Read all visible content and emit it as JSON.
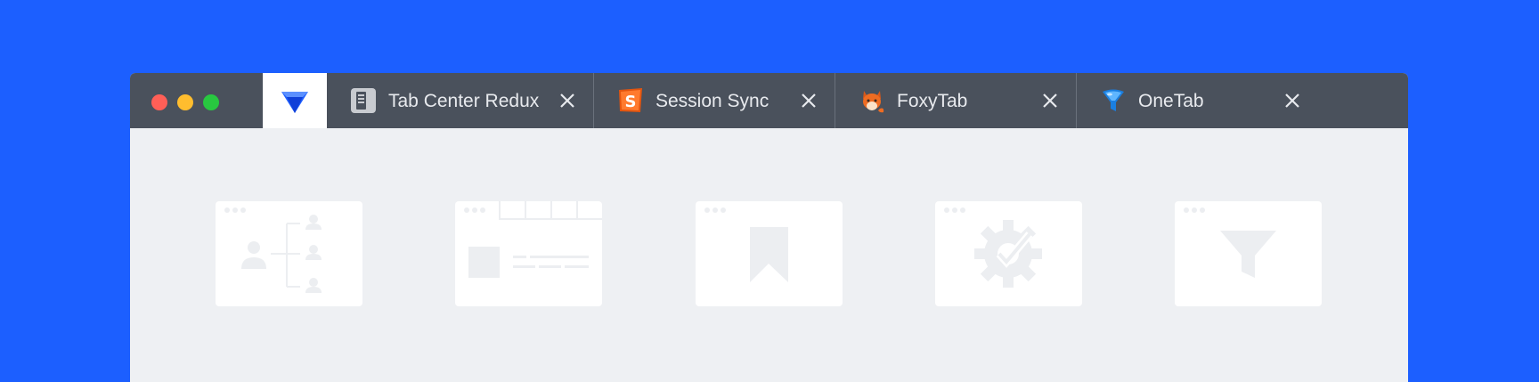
{
  "window": {
    "traffic_lights": [
      "close",
      "minimize",
      "zoom"
    ]
  },
  "tabs": {
    "pinned": {
      "icon": "blue-gem-icon"
    },
    "items": [
      {
        "label": "Tab Center Redux",
        "icon": "document-icon",
        "close": "close-icon"
      },
      {
        "label": "Session Sync",
        "icon": "s-logo-icon",
        "close": "close-icon"
      },
      {
        "label": "FoxyTab",
        "icon": "fox-icon",
        "close": "close-icon"
      },
      {
        "label": "OneTab",
        "icon": "funnel-icon",
        "close": "close-icon"
      }
    ]
  },
  "placeholders": [
    {
      "icon": "org-chart-icon"
    },
    {
      "icon": "tab-layout-icon"
    },
    {
      "icon": "bookmark-icon"
    },
    {
      "icon": "gear-check-icon"
    },
    {
      "icon": "filter-icon"
    }
  ],
  "colors": {
    "background": "#1c5fff",
    "tabbar": "#4a515c",
    "content": "#eef0f3",
    "placeholder_shapes": "#eceef1"
  }
}
